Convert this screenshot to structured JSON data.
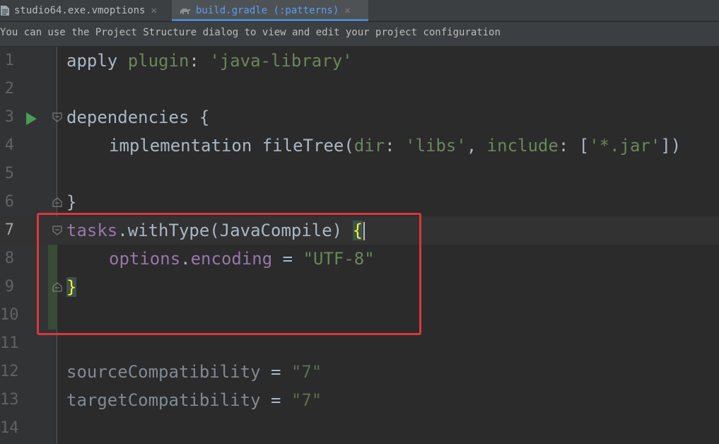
{
  "tabs": [
    {
      "label": "studio64.exe.vmoptions",
      "icon": "file-icon"
    },
    {
      "label": "build.gradle (:patterns)",
      "icon": "gradle-elephant-icon",
      "active": true
    }
  ],
  "notification": {
    "text": "You can use the Project Structure dialog to view and edit your project configuration"
  },
  "editor": {
    "line_numbers": [
      "1",
      "2",
      "3",
      "4",
      "5",
      "6",
      "7",
      "8",
      "9",
      "10",
      "11",
      "12",
      "13",
      "14"
    ],
    "current_line": "7",
    "code": {
      "l1": {
        "apply": "apply",
        "plugin": "plugin",
        "colon": ":",
        "value": "'java-library'"
      },
      "l3": {
        "dependencies": "dependencies",
        "brace": "{"
      },
      "l4": {
        "implementation": "implementation",
        "call": "fileTree(",
        "dir": "dir",
        "colon1": ": ",
        "libs": "'libs'",
        "comma": ", ",
        "include": "include",
        "colon2": ": ",
        "open": "[",
        "jar": "'*.jar'",
        "close": "])"
      },
      "l6": {
        "brace": "}"
      },
      "l7": {
        "tasks": "tasks",
        "rest": ".withType(JavaCompile) ",
        "brace": "{"
      },
      "l8": {
        "options": "options",
        "dot": ".",
        "encoding": "encoding",
        "eq": " = ",
        "value": "\"UTF-8\""
      },
      "l9": {
        "brace": "}"
      },
      "l12": {
        "name": "sourceCompatibility",
        "eq": " = ",
        "value": "\"7\""
      },
      "l13": {
        "name": "targetCompatibility",
        "eq": " = ",
        "value": "\"7\""
      }
    }
  },
  "colors": {
    "annotation": "#d9373b",
    "run": "#499c54",
    "brace_highlight": "#ffef28"
  }
}
